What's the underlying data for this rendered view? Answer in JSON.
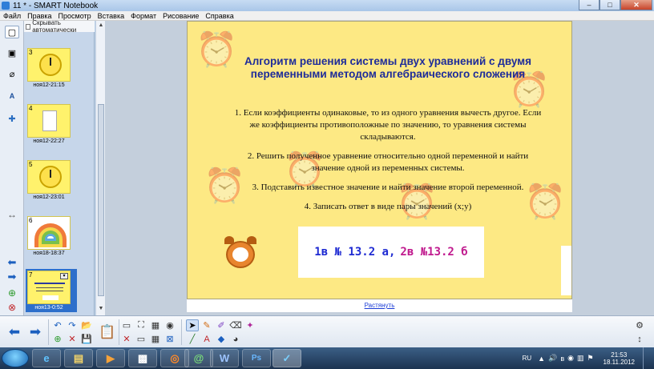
{
  "window": {
    "title": "11 * - SMART Notebook",
    "controls": {
      "minimize": "–",
      "maximize": "□",
      "close": "✕"
    }
  },
  "menu": [
    "Файл",
    "Правка",
    "Просмотр",
    "Вставка",
    "Формат",
    "Рисование",
    "Справка"
  ],
  "left_tools": [
    {
      "icon": "page-sorter-icon",
      "glyph": "▢"
    },
    {
      "icon": "gallery-icon",
      "glyph": "▣"
    },
    {
      "icon": "attachments-icon",
      "glyph": "⌀"
    },
    {
      "icon": "properties-icon",
      "glyph": "A"
    },
    {
      "icon": "addons-icon",
      "glyph": "✚"
    }
  ],
  "sorter": {
    "autohide_label": "Скрывать автоматически",
    "pages": [
      {
        "num": "3",
        "caption": "ноя12-21:15",
        "kind": "clock"
      },
      {
        "num": "4",
        "caption": "ноя12-22:27",
        "kind": "doc"
      },
      {
        "num": "5",
        "caption": "ноя12-23:01",
        "kind": "clock"
      },
      {
        "num": "6",
        "caption": "ноя18-18:37",
        "kind": "rainbow"
      },
      {
        "num": "7",
        "caption": "ноя13-0:52",
        "kind": "text",
        "selected": true
      }
    ]
  },
  "slide": {
    "heading": "Алгоритм решения системы двух уравнений с двумя переменными методом алгебраического сложения",
    "steps": [
      "1. Если коэффициенты одинаковые, то из одного уравнения вычесть другое. Если же коэффициенты противоположные по значению, то уравнения системы складываются.",
      "2. Решить полученное уравнение относительно одной переменной и найти значение одной из переменных системы.",
      "3. Подставить известное значение и найти значение второй переменной.",
      "4. Записать ответ в виде пары значений (x;y)"
    ],
    "answer_part1": "1в № 13.2 а,",
    "answer_part2": "2в №13.2 б",
    "footer_link": "Растянуть"
  },
  "toolbar": {
    "buttons": [
      {
        "icon": "previous-page-icon",
        "glyph": "⬅"
      },
      {
        "icon": "next-page-icon",
        "glyph": "➡"
      },
      {
        "icon": "undo-icon",
        "glyph": "↶"
      },
      {
        "icon": "redo-icon",
        "glyph": "↷"
      },
      {
        "icon": "open-icon",
        "glyph": "📂"
      },
      {
        "icon": "add-page-icon",
        "glyph": "⊕"
      },
      {
        "icon": "delete-icon",
        "glyph": "✕"
      },
      {
        "icon": "save-icon",
        "glyph": "💾"
      },
      {
        "icon": "paste-icon",
        "glyph": "📋"
      },
      {
        "icon": "screen-shade-icon",
        "glyph": "▭"
      },
      {
        "icon": "full-screen-icon",
        "glyph": "⛶"
      },
      {
        "icon": "table-icon",
        "glyph": "▦"
      },
      {
        "icon": "document-camera-icon",
        "glyph": "◉"
      },
      {
        "icon": "select-icon",
        "glyph": "➤"
      },
      {
        "icon": "pens-icon",
        "glyph": "✎"
      },
      {
        "icon": "creative-pens-icon",
        "glyph": "✐"
      },
      {
        "icon": "eraser-icon",
        "glyph": "⌫"
      },
      {
        "icon": "lines-icon",
        "glyph": "╱"
      },
      {
        "icon": "shapes-icon",
        "glyph": "◆"
      },
      {
        "icon": "text-icon",
        "glyph": "A"
      },
      {
        "icon": "fill-icon",
        "glyph": "◕"
      },
      {
        "icon": "magic-pen-icon",
        "glyph": "✦"
      },
      {
        "icon": "settings-icon",
        "glyph": "⚙"
      },
      {
        "icon": "move-toolbar-icon",
        "glyph": "↕"
      }
    ]
  },
  "taskbar": {
    "apps": [
      {
        "icon": "internet-explorer-icon",
        "glyph": "e"
      },
      {
        "icon": "explorer-icon",
        "glyph": "▤"
      },
      {
        "icon": "media-player-icon",
        "glyph": "▶"
      },
      {
        "icon": "clapperboard-icon",
        "glyph": "▩"
      },
      {
        "icon": "firefox-icon",
        "glyph": "◎"
      },
      {
        "icon": "agent-icon",
        "glyph": "@"
      },
      {
        "icon": "word-icon",
        "glyph": "W"
      },
      {
        "icon": "photoshop-icon",
        "glyph": "Ps"
      },
      {
        "icon": "smart-notebook-icon",
        "glyph": "✓"
      }
    ],
    "lang": "RU",
    "time": "21:53",
    "date": "18.11.2012"
  }
}
